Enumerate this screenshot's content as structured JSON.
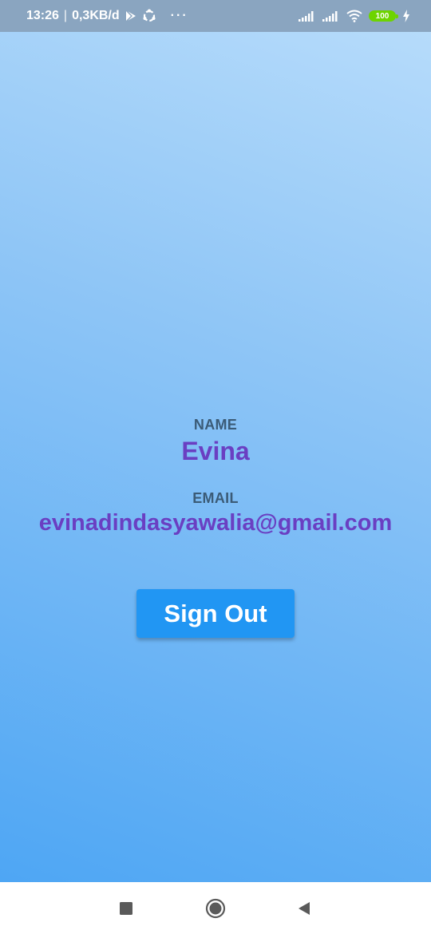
{
  "status_bar": {
    "time": "13:26",
    "separator": "|",
    "net_speed": "0,3KB/d",
    "more": "···",
    "battery": "100",
    "icons": [
      "play-store-icon",
      "sync-icon",
      "signal-icon",
      "signal-icon",
      "wifi-icon",
      "battery-icon",
      "charging-icon"
    ]
  },
  "profile": {
    "name_label": "NAME",
    "name": "Evina",
    "email_label": "EMAIL",
    "email": "evinadindasyawalia@gmail.com"
  },
  "actions": {
    "sign_out_label": "Sign Out"
  },
  "colors": {
    "background_top": "#b9ddfb",
    "background_bottom": "#4ea6f4",
    "label": "#3b5b77",
    "value": "#6a3fc2",
    "button": "#2196f3"
  },
  "nav_bar": {
    "icons": [
      "recent-apps-icon",
      "home-icon",
      "back-icon"
    ]
  }
}
